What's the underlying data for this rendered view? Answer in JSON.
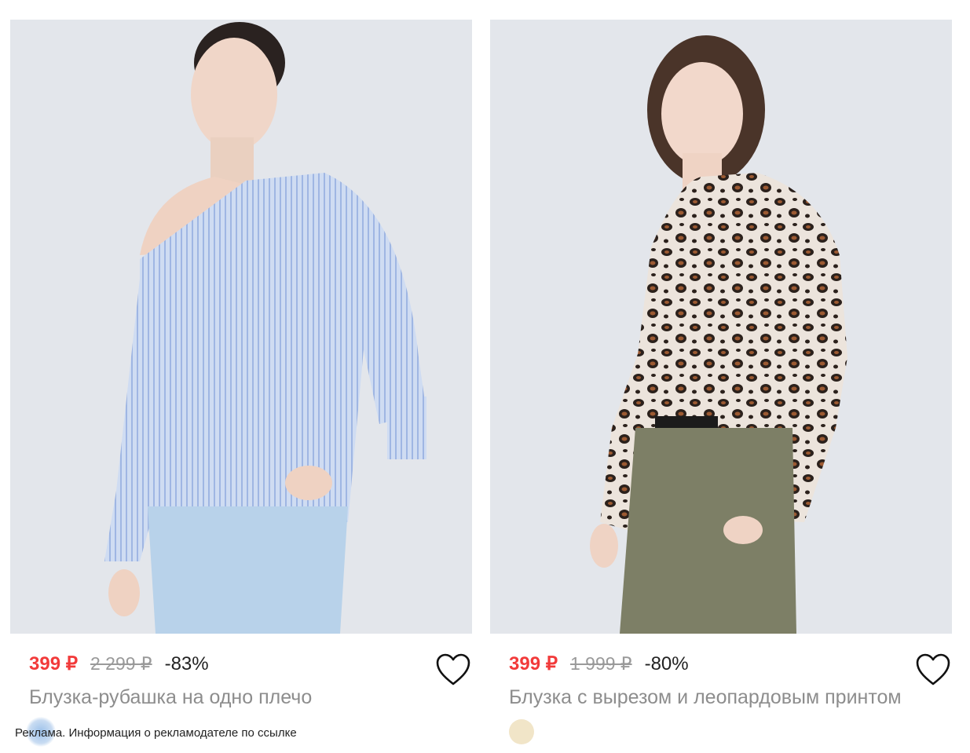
{
  "products": [
    {
      "price": "399 ₽",
      "old_price": "2 299 ₽",
      "discount": "-83%",
      "title": "Блузка-рубашка на одно плечо",
      "ad_label": "Реклама. Информация о рекламодателе по ссылке"
    },
    {
      "price": "399 ₽",
      "old_price": "1 999 ₽",
      "discount": "-80%",
      "title": "Блузка с вырезом и леопардовым принтом",
      "swatch_color": "#f1e5c8"
    }
  ],
  "colors": {
    "price": "#f23a3a",
    "old_price": "#9a9a9a",
    "title": "#8d8d8d",
    "photo_background": "#e3e6eb"
  },
  "icons": {
    "favorite": "heart-outline-icon"
  }
}
